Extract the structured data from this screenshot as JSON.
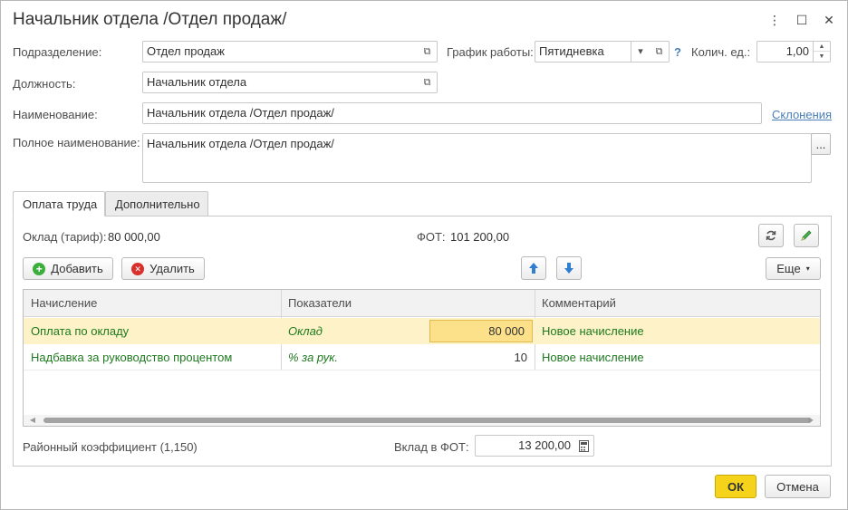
{
  "window": {
    "title": "Начальник отдела /Отдел продаж/",
    "more_glyph": "⋮",
    "maximize_glyph": "☐",
    "close_glyph": "✕"
  },
  "form": {
    "division_label": "Подразделение:",
    "division_value": "Отдел продаж",
    "schedule_label": "График работы:",
    "schedule_value": "Пятидневка",
    "help_glyph": "?",
    "units_label": "Колич. ед.:",
    "units_value": "1,00",
    "position_label": "Должность:",
    "position_value": "Начальник отдела",
    "name_label": "Наименование:",
    "name_value": "Начальник отдела /Отдел продаж/",
    "declensions_link": "Склонения",
    "fullname_label": "Полное наименование:",
    "fullname_value": "Начальник отдела /Отдел продаж/",
    "ellipsis": "..."
  },
  "tabs": [
    {
      "label": "Оплата труда",
      "active": true
    },
    {
      "label": "Дополнительно",
      "active": false
    }
  ],
  "pay": {
    "salary_label": "Оклад (тариф):",
    "salary_value": "80 000,00",
    "fot_label": "ФОТ:",
    "fot_value": "101 200,00",
    "add_label": "Добавить",
    "delete_label": "Удалить",
    "more_label": "Еще",
    "grid": {
      "columns": [
        "Начисление",
        "Показатели",
        "Комментарий"
      ],
      "rows": [
        {
          "accrual": "Оплата по окладу",
          "indicator": "Оклад",
          "value": "80 000",
          "comment": "Новое начисление",
          "selected": true
        },
        {
          "accrual": "Надбавка за руководство процентом",
          "indicator": "% за рук.",
          "value": "10",
          "comment": "Новое начисление",
          "selected": false
        }
      ]
    },
    "district_coef": "Районный коэффициент (1,150)",
    "contrib_label": "Вклад в ФОТ:",
    "contrib_value": "13 200,00"
  },
  "footer": {
    "ok_label": "ОК",
    "cancel_label": "Отмена"
  },
  "colors": {
    "accrual_text": "#1e7a1e",
    "selected_row": "#fdf2c8",
    "ok_button": "#f4d31a",
    "link": "#4a7fb8"
  }
}
